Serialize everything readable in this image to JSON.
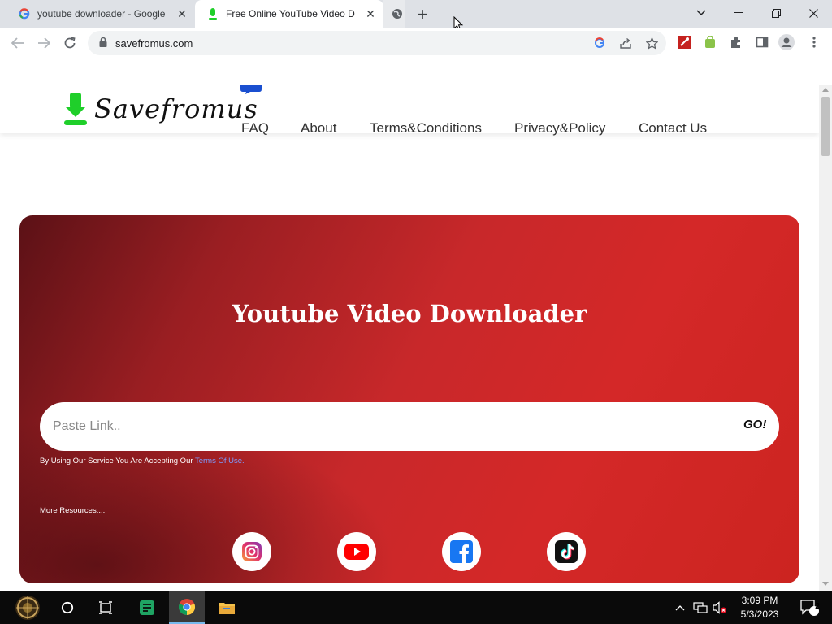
{
  "browser": {
    "tabs": [
      {
        "title": "youtube downloader - Google",
        "favicon": "google-icon",
        "active": false
      },
      {
        "title": "Free Online YouTube Video D",
        "favicon": "savefromus-mic-icon",
        "active": true
      },
      {
        "title": "",
        "favicon": "globe-icon",
        "active": false
      }
    ],
    "url": "savefromus.com"
  },
  "site": {
    "brand": "Savefromus",
    "nav": [
      "FAQ",
      "About",
      "Terms&Conditions",
      "Privacy&Policy",
      "Contact Us"
    ]
  },
  "hero": {
    "title": "Youtube Video Downloader",
    "input_placeholder": "Paste Link..",
    "go_label": "GO!",
    "terms_prefix": "By Using Our Service You Are Accepting Our",
    "terms_link": "Terms Of Use.",
    "more_resources": "More Resources....",
    "social": [
      "instagram-icon",
      "youtube-icon",
      "facebook-icon",
      "tiktok-icon"
    ]
  },
  "taskbar": {
    "time": "3:09 PM",
    "date": "5/3/2023",
    "notification_count": "2"
  },
  "colors": {
    "hero_red": "#d42828",
    "hero_dark": "#5b1116",
    "brand_green": "#1fcf2a",
    "link_blue": "#7b9cff"
  }
}
